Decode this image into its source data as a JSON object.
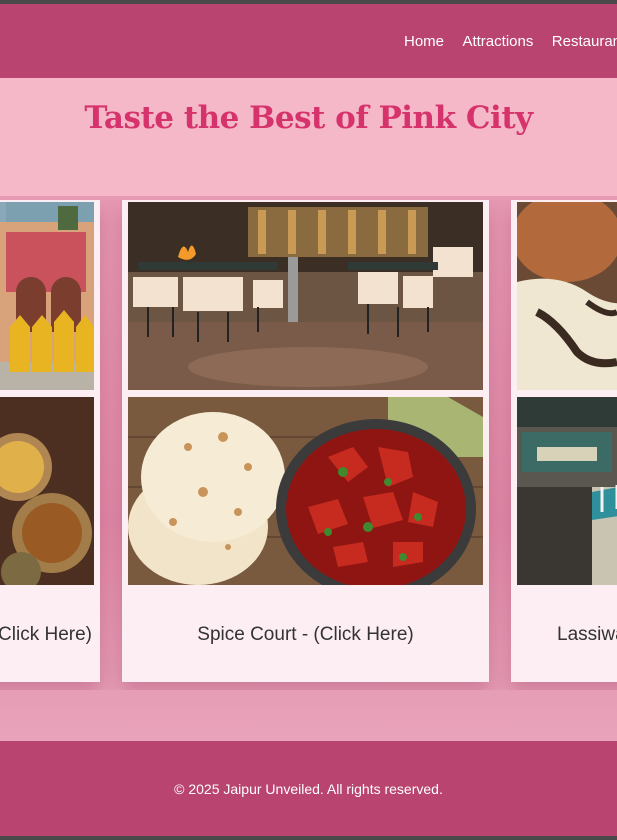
{
  "nav": {
    "links": [
      "Home",
      "Attractions",
      "Restaurants"
    ]
  },
  "hero": {
    "title": "Taste the Best of Pink City"
  },
  "cards": [
    {
      "label": "- (Click Here)"
    },
    {
      "label": "Spice Court - (Click Here)"
    },
    {
      "label": "Lassiwala - (Click Here)"
    }
  ],
  "footer": {
    "copyright": "© 2025 Jaipur Unveiled. All rights reserved."
  },
  "colors": {
    "header": "#b9446f",
    "page": "#f4b8c8",
    "title": "#d6336c",
    "card": "#fdeef3"
  }
}
